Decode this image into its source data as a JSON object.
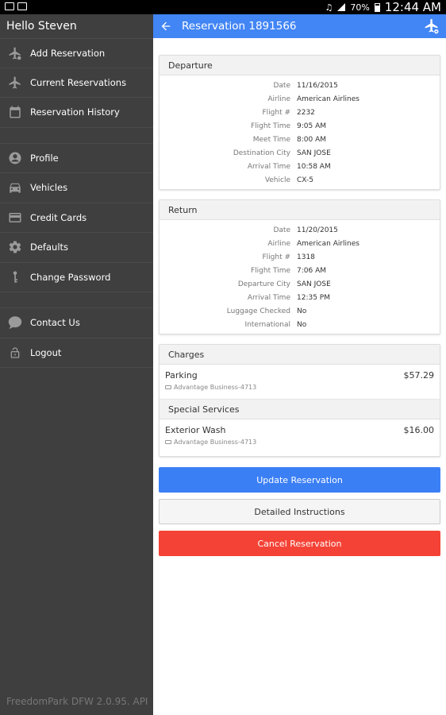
{
  "status_bar": {
    "battery": "70%",
    "time": "12:44 AM"
  },
  "sidebar": {
    "greeting": "Hello Steven",
    "items": [
      {
        "label": "Add Reservation",
        "icon": "airplane-add-icon"
      },
      {
        "label": "Current Reservations",
        "icon": "airplane-icon"
      },
      {
        "label": "Reservation History",
        "icon": "calendar-icon"
      },
      {
        "label": "Profile",
        "icon": "profile-icon"
      },
      {
        "label": "Vehicles",
        "icon": "car-icon"
      },
      {
        "label": "Credit Cards",
        "icon": "credit-card-icon"
      },
      {
        "label": "Defaults",
        "icon": "gear-icon"
      },
      {
        "label": "Change Password",
        "icon": "key-icon"
      },
      {
        "label": "Contact Us",
        "icon": "chat-icon"
      },
      {
        "label": "Logout",
        "icon": "lock-icon"
      }
    ],
    "version": "FreedomPark DFW 2.0.95. API"
  },
  "appbar": {
    "title": "Reservation 1891566"
  },
  "departure": {
    "title": "Departure",
    "rows": [
      {
        "label": "Date",
        "value": "11/16/2015"
      },
      {
        "label": "Airline",
        "value": "American Airlines"
      },
      {
        "label": "Flight #",
        "value": "2232"
      },
      {
        "label": "Flight Time",
        "value": "9:05 AM"
      },
      {
        "label": "Meet Time",
        "value": "8:00 AM"
      },
      {
        "label": "Destination City",
        "value": "SAN JOSE"
      },
      {
        "label": "Arrival Time",
        "value": "10:58 AM"
      },
      {
        "label": "Vehicle",
        "value": "CX-5"
      }
    ]
  },
  "return": {
    "title": "Return",
    "rows": [
      {
        "label": "Date",
        "value": "11/20/2015"
      },
      {
        "label": "Airline",
        "value": "American Airlines"
      },
      {
        "label": "Flight #",
        "value": "1318"
      },
      {
        "label": "Flight Time",
        "value": "7:06 AM"
      },
      {
        "label": "Departure City",
        "value": "SAN JOSE"
      },
      {
        "label": "Arrival Time",
        "value": "12:35 PM"
      },
      {
        "label": "Luggage Checked",
        "value": "No"
      },
      {
        "label": "International",
        "value": "No"
      }
    ]
  },
  "charges": {
    "title": "Charges",
    "items": [
      {
        "name": "Parking",
        "amount": "$57.29",
        "card": "Advantage Business-4713"
      }
    ],
    "special_title": "Special Services",
    "special": [
      {
        "name": "Exterior Wash",
        "amount": "$16.00",
        "card": "Advantage Business-4713"
      }
    ]
  },
  "buttons": {
    "update": "Update Reservation",
    "detailed": "Detailed Instructions",
    "cancel": "Cancel Reservation"
  },
  "colors": {
    "primary": "#4285f4",
    "danger": "#f44336",
    "sidebar_bg": "#3f3f3f"
  }
}
